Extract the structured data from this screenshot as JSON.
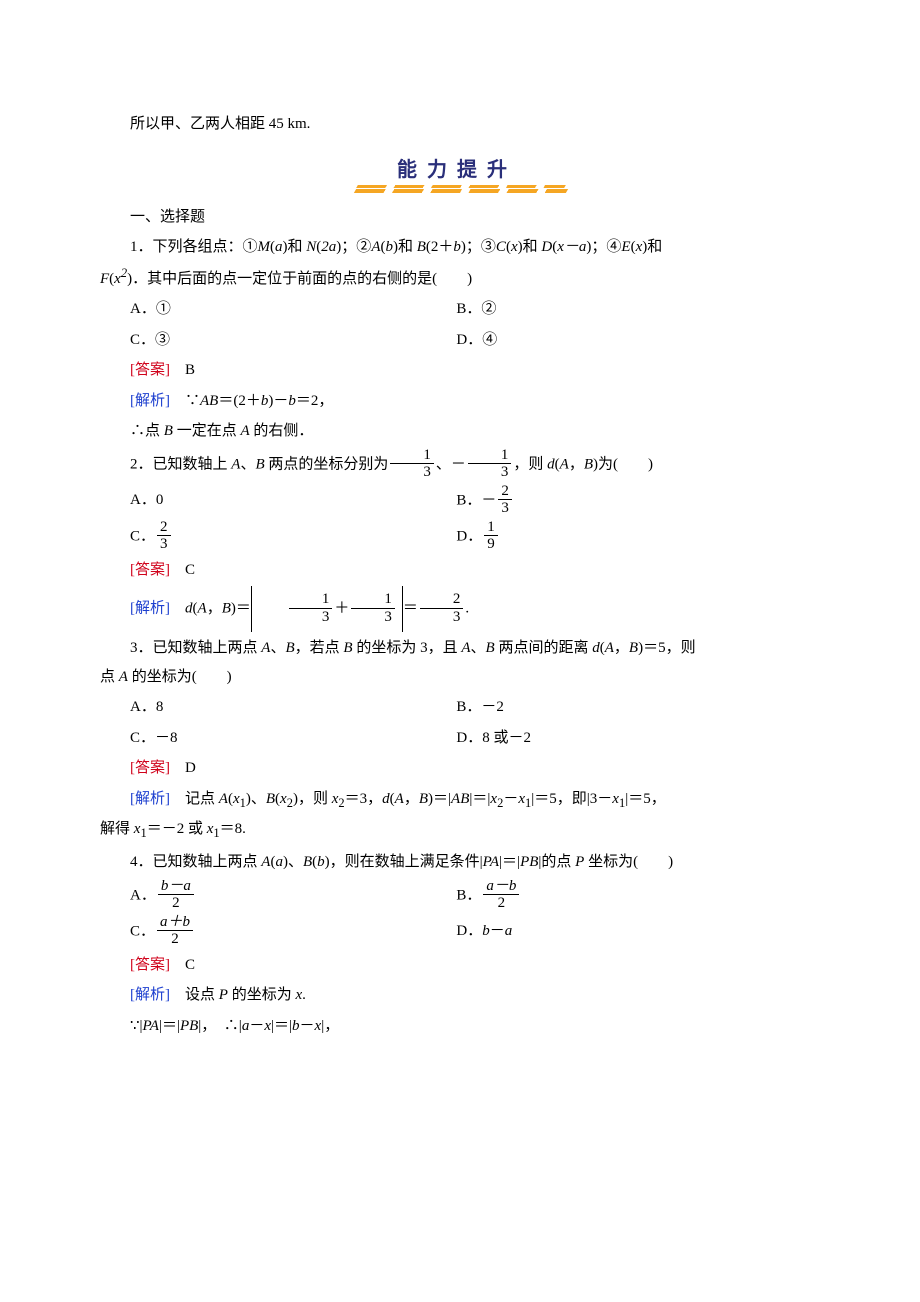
{
  "intro_line": "所以甲、乙两人相距 45 km.",
  "banner": "能力提升",
  "section": "一、选择题",
  "q1": {
    "stem_a": "1．下列各组点：①",
    "stem_b": "和 ",
    "stem_c": "；②",
    "stem_d": ")和 ",
    "stem_e": ")；③",
    "stem_f": "和 ",
    "stem_g": "；④",
    "stem_h": "和",
    "line2": ")．其中后面的点一定位于前面的点的右侧的是(　　)",
    "A": "A．①",
    "B": "B．②",
    "C": "C．③",
    "D": "D．④",
    "ans_l": "[答案]",
    "ans_v": "　B",
    "ex_l": "[解析]",
    "ex1a": "　∵",
    "ex1b": "＝(2＋",
    "ex1c": ")－",
    "ex1d": "＝2，",
    "ex2a": "∴点 ",
    "ex2b": " 一定在点 ",
    "ex2c": " 的右侧．"
  },
  "q2": {
    "stem_a": "2．已知数轴上 ",
    "stem_b": "、",
    "stem_c": " 两点的坐标分别为",
    "stem_d": "、－",
    "stem_e": "，则 ",
    "stem_f": "，",
    "stem_g": "为(　　)",
    "Aa": "A．0",
    "Ba": "B．－",
    "Ca": "C．",
    "Da": "D．",
    "ans_l": "[答案]",
    "ans_v": "　C",
    "ex_l": "[解析]",
    "ex_b": "，",
    "ex_c": "＝",
    "ex_d": "＋",
    "ex_e": "＝",
    "ex_f": "."
  },
  "q3": {
    "stem_a": "3．已知数轴上两点 ",
    "stem_b": "、",
    "stem_c": "，若点 ",
    "stem_d": " 的坐标为 3，且 ",
    "stem_e": "、",
    "stem_f": " 两点间的距离 ",
    "stem_g": "，",
    "stem_h": "＝5，则",
    "line2a": "点 ",
    "line2b": " 的坐标为(　　)",
    "A": "A．8",
    "B": "B．－2",
    "C": "C．－8",
    "D": "D．8 或－2",
    "ans_l": "[答案]",
    "ans_v": "　D",
    "ex_l": "[解析]",
    "ex1a": "　记点 ",
    "ex1b": "、",
    "ex1c": "，则 ",
    "ex1d": "＝3，",
    "ex1e": "，",
    "ex1f": "＝|",
    "ex1g": "|＝|",
    "ex1h": "－",
    "ex1i": "|＝5，即|3－",
    "ex1j": "|＝5，",
    "ex2a": "解得 ",
    "ex2b": "＝－2 或 ",
    "ex2c": "＝8."
  },
  "q4": {
    "stem_a": "4．已知数轴上两点 ",
    "stem_b": "、",
    "stem_c": "，则在数轴上满足条件|",
    "stem_d": "|＝|",
    "stem_e": "|的点 ",
    "stem_f": " 坐标为(　　)",
    "Aa": "A．",
    "Ba": "B．",
    "Ca": "C．",
    "Da": "D．",
    "Db": "－",
    "ans_l": "[答案]",
    "ans_v": "　C",
    "ex_l": "[解析]",
    "ex1a": "　设点 ",
    "ex1b": " 的坐标为 ",
    "ex1c": ".",
    "ex2a": "∵|",
    "ex2b": "|＝|",
    "ex2c": "|，　∴|",
    "ex2d": "－",
    "ex2e": "|＝|",
    "ex2f": "－",
    "ex2g": "|，"
  },
  "sym": {
    "M": "M",
    "N": "N",
    "A": "A",
    "B": "B",
    "C": "C",
    "D": "D",
    "E": "E",
    "F": "F",
    "P": "P",
    "a": "a",
    "b": "b",
    "x": "x",
    "d": "d",
    "x1": "x",
    "x2": "x",
    "sub1": "1",
    "sub2": "2",
    "two_a": "2a",
    "b_minus_a": "b－a",
    "a_minus_b": "a－b",
    "a_plus_b": "a＋b",
    "x_minus_a": "x－a",
    "PA": "PA",
    "PB": "PB",
    "AB": "AB",
    "lp": "(",
    "rp": ")",
    "sq_exp": "2"
  }
}
